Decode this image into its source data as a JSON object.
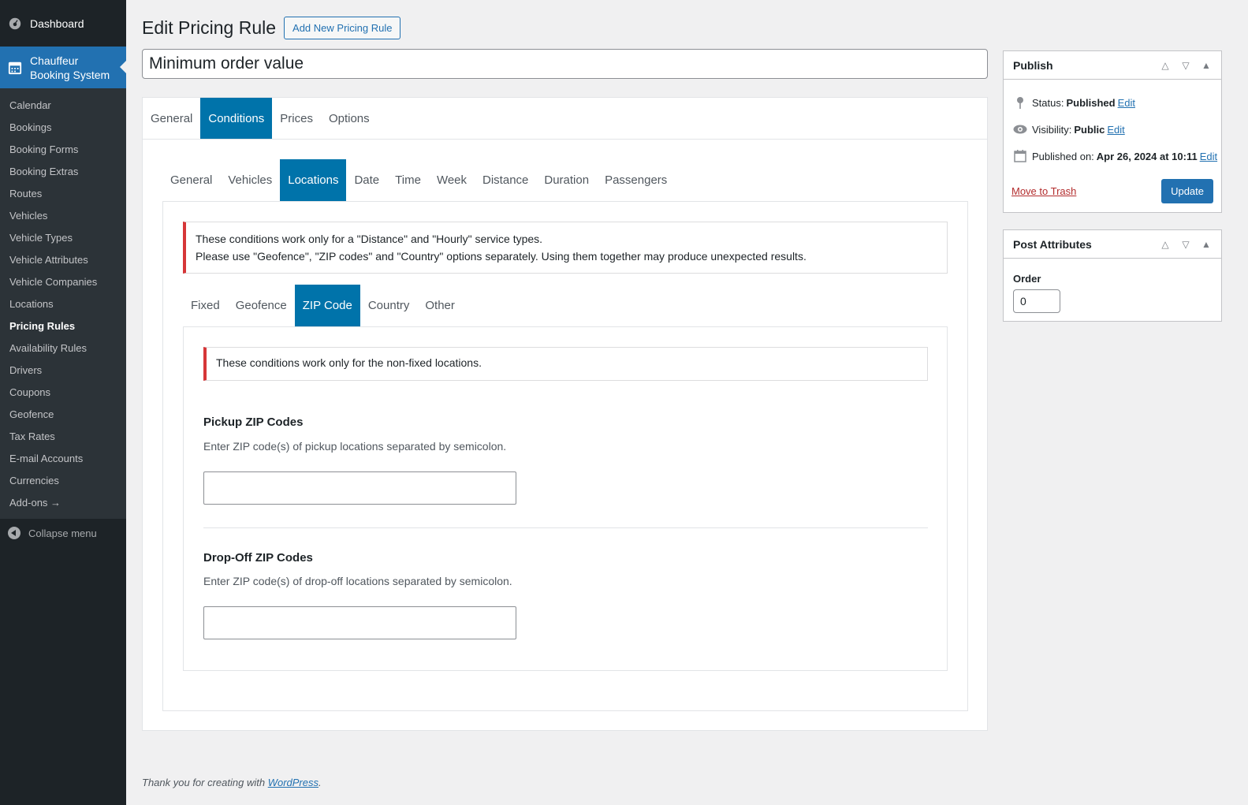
{
  "sidebar": {
    "dashboard": "Dashboard",
    "plugin_line1": "Chauffeur",
    "plugin_line2": "Booking System",
    "items": [
      "Calendar",
      "Bookings",
      "Booking Forms",
      "Booking Extras",
      "Routes",
      "Vehicles",
      "Vehicle Types",
      "Vehicle Attributes",
      "Vehicle Companies",
      "Locations",
      "Pricing Rules",
      "Availability Rules",
      "Drivers",
      "Coupons",
      "Geofence",
      "Tax Rates",
      "E-mail Accounts",
      "Currencies",
      "Add-ons →"
    ],
    "current_item": "Pricing Rules",
    "collapse": "Collapse menu"
  },
  "header": {
    "title": "Edit Pricing Rule",
    "add_new": "Add New Pricing Rule"
  },
  "post_title": "Minimum order value",
  "tabs_main": [
    "General",
    "Conditions",
    "Prices",
    "Options"
  ],
  "tabs_main_active": "Conditions",
  "tabs_cond": [
    "General",
    "Vehicles",
    "Locations",
    "Date",
    "Time",
    "Week",
    "Distance",
    "Duration",
    "Passengers"
  ],
  "tabs_cond_active": "Locations",
  "notice1": {
    "line1": "These conditions work only for a \"Distance\" and \"Hourly\" service types.",
    "line2": "Please use \"Geofence\", \"ZIP codes\" and \"Country\" options separately. Using them together may produce unexpected results."
  },
  "tabs_loc": [
    "Fixed",
    "Geofence",
    "ZIP Code",
    "Country",
    "Other"
  ],
  "tabs_loc_active": "ZIP Code",
  "notice2": "These conditions work only for the non-fixed locations.",
  "pickup": {
    "title": "Pickup ZIP Codes",
    "desc": "Enter ZIP code(s) of pickup locations separated by semicolon.",
    "value": ""
  },
  "dropoff": {
    "title": "Drop-Off ZIP Codes",
    "desc": "Enter ZIP code(s) of drop-off locations separated by semicolon.",
    "value": ""
  },
  "footer": {
    "text": "Thank you for creating with ",
    "link": "WordPress",
    "end": "."
  },
  "publish": {
    "title": "Publish",
    "status_label": "Status:",
    "status_value": "Published",
    "visibility_label": "Visibility:",
    "visibility_value": "Public",
    "published_label": "Published on:",
    "published_value": "Apr 26, 2024 at 10:11",
    "edit": "Edit",
    "trash": "Move to Trash",
    "update": "Update"
  },
  "attributes": {
    "title": "Post Attributes",
    "order_label": "Order",
    "order_value": "0"
  },
  "colors": {
    "sidebar": "#1d2327",
    "accent": "#2271b1",
    "tab_active": "#0073aa",
    "notice_border": "#d63638"
  }
}
